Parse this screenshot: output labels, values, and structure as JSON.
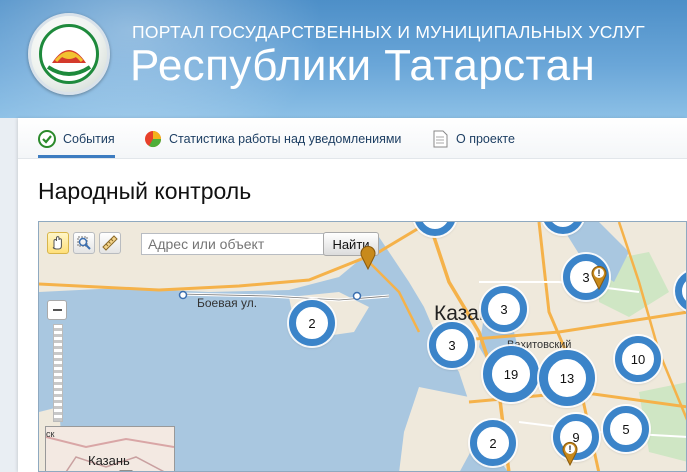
{
  "header": {
    "line1": "ПОРТАЛ ГОСУДАРСТВЕННЫХ И МУНИЦИПАЛЬНЫХ УСЛУГ",
    "line2": "Республики Татарстан",
    "emblem_icon": "tatarstan-emblem-icon"
  },
  "nav": {
    "items": [
      {
        "label": "События",
        "icon": "green-check-icon"
      },
      {
        "label": "Статистика работы над уведомлениями",
        "icon": "pie-chart-icon"
      },
      {
        "label": "О проекте",
        "icon": "document-icon"
      }
    ]
  },
  "page": {
    "title": "Народный контроль"
  },
  "map": {
    "search_placeholder": "Адрес или объект",
    "find_label": "Найти",
    "tools": [
      "hand-pan-icon",
      "magnifier-zoom-icon",
      "ruler-icon"
    ],
    "labels": {
      "street": "Боевая ул.",
      "city": "Казань",
      "district": "Вахитовский",
      "minimap_city": "Казань",
      "minimap_small": "ск"
    },
    "clusters": [
      {
        "count": "2"
      },
      {
        "count": "3"
      },
      {
        "count": "3"
      },
      {
        "count": "19"
      },
      {
        "count": "13"
      },
      {
        "count": "3"
      },
      {
        "count": "10"
      },
      {
        "count": "5"
      },
      {
        "count": "2"
      },
      {
        "count": "9"
      }
    ],
    "colors": {
      "water": "#a9c7e0",
      "land": "#efe9dc",
      "road": "#f5b24a",
      "cluster": "#3b84c9"
    }
  }
}
